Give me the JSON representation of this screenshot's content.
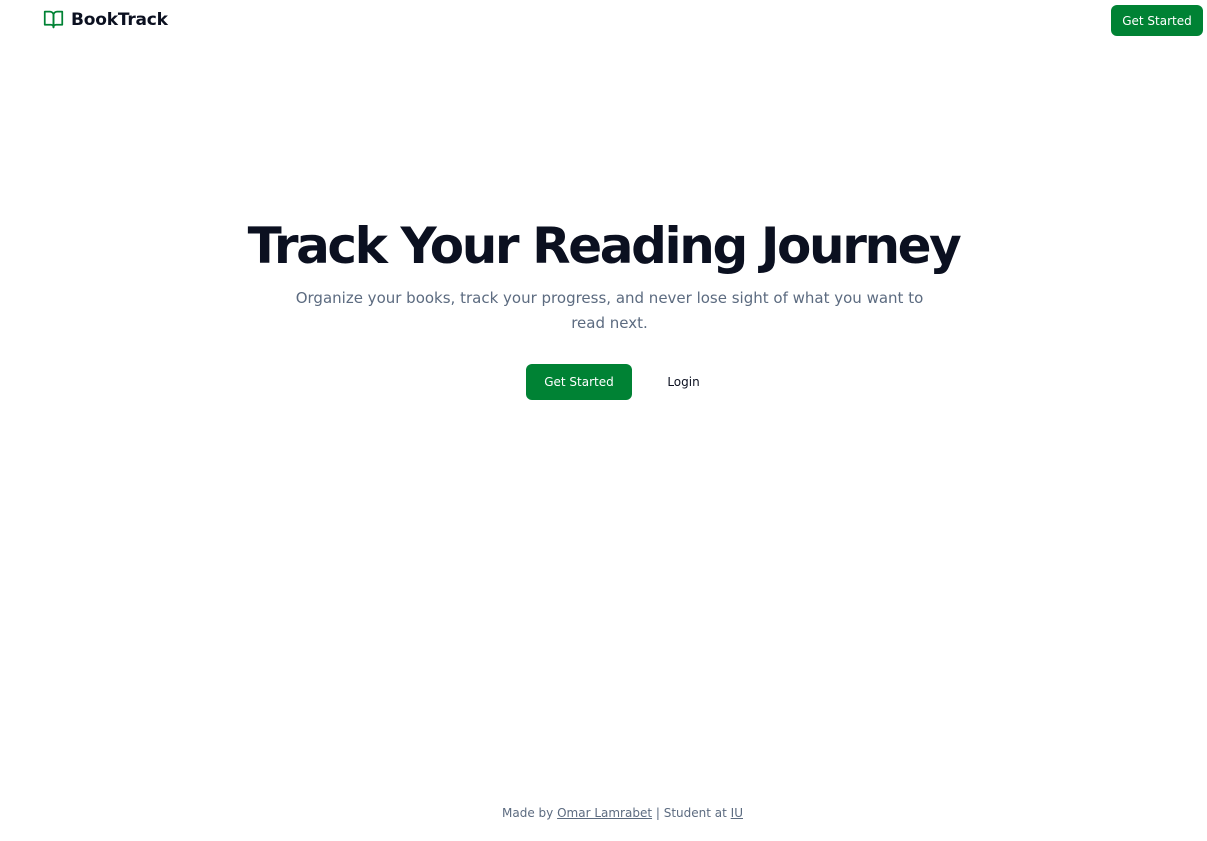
{
  "header": {
    "brand_name": "BookTrack",
    "brand_icon": "open-book-icon",
    "cta_label": "Get Started"
  },
  "hero": {
    "title": "Track Your Reading Journey",
    "subtitle": "Organize your books, track your progress, and never lose sight of what you want to read next.",
    "primary_label": "Get Started",
    "secondary_label": "Login"
  },
  "footer": {
    "prefix": "Made by",
    "author": "Omar Lamrabet",
    "separator": "| Student at",
    "school": "IU"
  },
  "colors": {
    "accent": "#008234",
    "text": "#0b1020",
    "muted": "#5c6b80",
    "background": "#ffffff"
  }
}
